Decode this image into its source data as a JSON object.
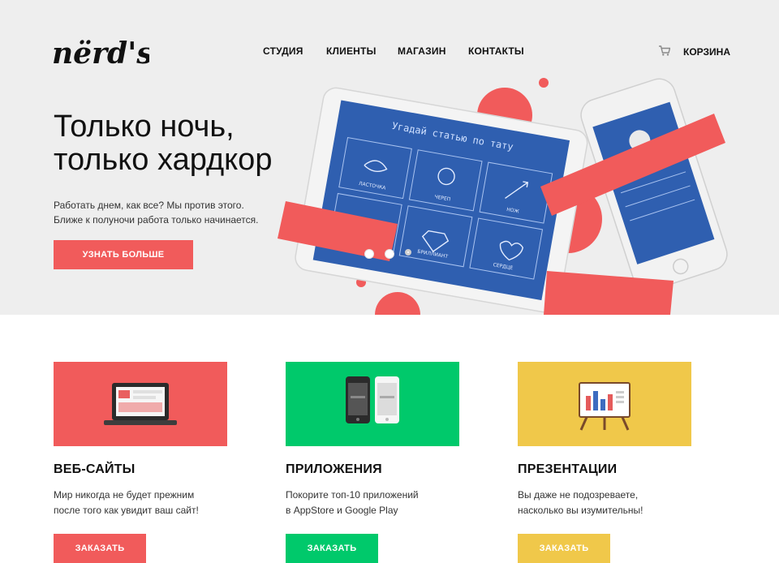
{
  "header": {
    "logo_text": "nërd's",
    "nav": [
      {
        "label": "СТУДИЯ"
      },
      {
        "label": "КЛИЕНТЫ"
      },
      {
        "label": "МАГАЗИН"
      },
      {
        "label": "КОНТАКТЫ"
      }
    ],
    "cart_label": "КОРЗИНА",
    "cart_icon": "cart-icon"
  },
  "hero": {
    "title_line1": "Только ночь,",
    "title_line2": "только хардкор",
    "text_line1": "Работать днем, как все? Мы против этого.",
    "text_line2": "Ближе к полуночи работа только начинается.",
    "button_label": "УЗНАТЬ БОЛЬШЕ",
    "tablet": {
      "heading": "Угадай статью по тату",
      "tiles": [
        "ЛАСТОЧКА",
        "ЧЕРЕП",
        "НОЖ",
        "",
        "БРИЛЛИАНТ",
        "СЕРДЦЕ"
      ]
    },
    "slider": {
      "count": 3,
      "active": 3
    }
  },
  "services": [
    {
      "title": "ВЕБ-САЙТЫ",
      "text_line1": "Мир никогда не будет прежним",
      "text_line2": "после того как увидит ваш сайт!",
      "button_label": "ЗАКАЗАТЬ",
      "color": "#f15b5b",
      "icon": "laptop-icon"
    },
    {
      "title": "ПРИЛОЖЕНИЯ",
      "text_line1": "Покорите топ-10 приложений",
      "text_line2": "в AppStore и Google Play",
      "button_label": "ЗАКАЗАТЬ",
      "color": "#00c96b",
      "icon": "phones-icon"
    },
    {
      "title": "ПРЕЗЕНТАЦИИ",
      "text_line1": "Вы даже не подозреваете,",
      "text_line2": "насколько вы изумительны!",
      "button_label": "ЗАКАЗАТЬ",
      "color": "#f0c84a",
      "icon": "presentation-board-icon"
    }
  ],
  "colors": {
    "accent_red": "#f15b5b",
    "accent_green": "#00c96b",
    "accent_yellow": "#f0c84a",
    "tablet_screen": "#2f5fb0",
    "hero_bg": "#eeeeee"
  }
}
